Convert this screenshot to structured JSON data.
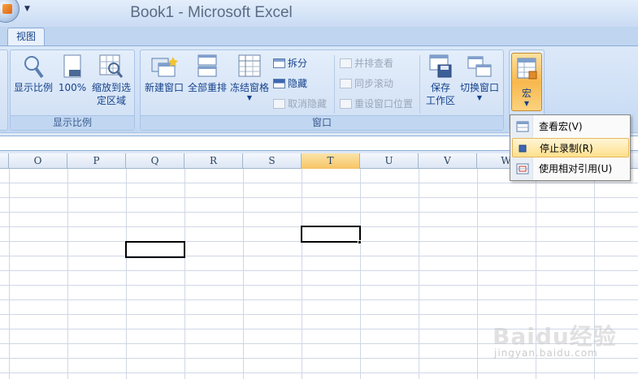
{
  "window": {
    "title": "Book1 - Microsoft Excel"
  },
  "tabs": [
    {
      "label": "视图",
      "active": true
    }
  ],
  "ribbon": {
    "zoom_group": {
      "label": "显示比例",
      "buttons": [
        {
          "label": "显示比例"
        },
        {
          "label": "100%"
        },
        {
          "label": "缩放到选定区域"
        }
      ]
    },
    "window_group": {
      "label": "窗口",
      "big_buttons": [
        {
          "label": "新建窗口"
        },
        {
          "label": "全部重排"
        },
        {
          "label": "冻结窗格"
        }
      ],
      "small_buttons_col1": [
        {
          "label": "拆分",
          "enabled": true
        },
        {
          "label": "隐藏",
          "enabled": true
        },
        {
          "label": "取消隐藏",
          "enabled": false
        }
      ],
      "small_buttons_col2": [
        {
          "label": "并排查看",
          "enabled": false
        },
        {
          "label": "同步滚动",
          "enabled": false
        },
        {
          "label": "重设窗口位置",
          "enabled": false
        }
      ],
      "save_workspace": {
        "line1": "保存",
        "line2": "工作区"
      },
      "switch_windows": {
        "label": "切换窗口"
      }
    },
    "macros_group": {
      "button_label": "宏"
    }
  },
  "columns": [
    {
      "name": "O",
      "active": false
    },
    {
      "name": "P",
      "active": false
    },
    {
      "name": "Q",
      "active": false
    },
    {
      "name": "R",
      "active": false
    },
    {
      "name": "S",
      "active": false
    },
    {
      "name": "T",
      "active": true
    },
    {
      "name": "U",
      "active": false
    },
    {
      "name": "V",
      "active": false
    },
    {
      "name": "W",
      "active": false
    }
  ],
  "macro_menu": {
    "items": [
      {
        "label": "查看宏(V)",
        "icon": "view-macros-icon",
        "highlighted": false
      },
      {
        "label": "停止录制(R)",
        "icon": "stop-recording-icon",
        "highlighted": true
      },
      {
        "label": "使用相对引用(U)",
        "icon": "relative-reference-icon",
        "highlighted": false
      }
    ]
  },
  "watermark": {
    "text": "Baidu经验",
    "url": "jingyan.baidu.com"
  },
  "colors": {
    "ribbon": "#cfe0f6",
    "active_column": "#f7c465",
    "menu_highlight": "#ffe08c"
  }
}
